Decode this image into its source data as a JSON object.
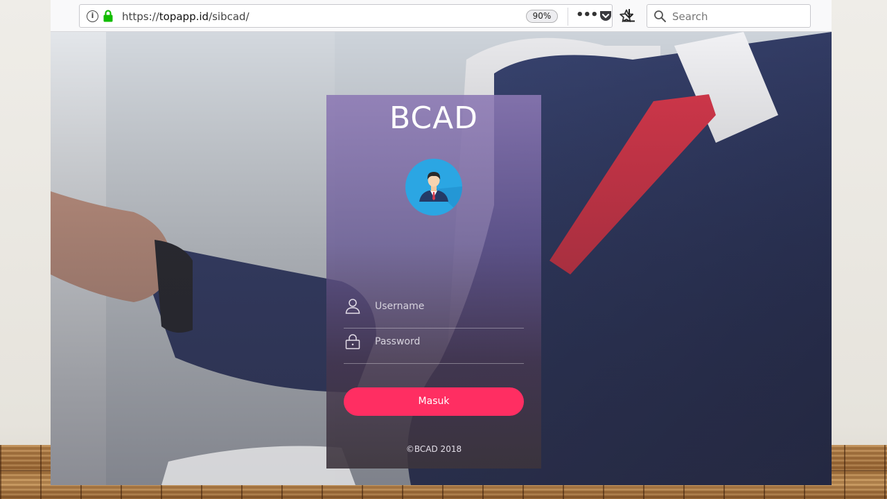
{
  "browser": {
    "url_prefix": "https://",
    "url_host": "topapp.id",
    "url_path": "/sibcad/",
    "zoom": "90%",
    "more_label": "•••",
    "search_placeholder": "Search"
  },
  "login": {
    "title": "BCAD",
    "username_placeholder": "Username",
    "password_placeholder": "Password",
    "submit_label": "Masuk",
    "footer": "©BCAD 2018"
  },
  "colors": {
    "button": "#ff2e62",
    "avatar_bg": "#2ba6e3",
    "lock_green": "#12bc00"
  }
}
